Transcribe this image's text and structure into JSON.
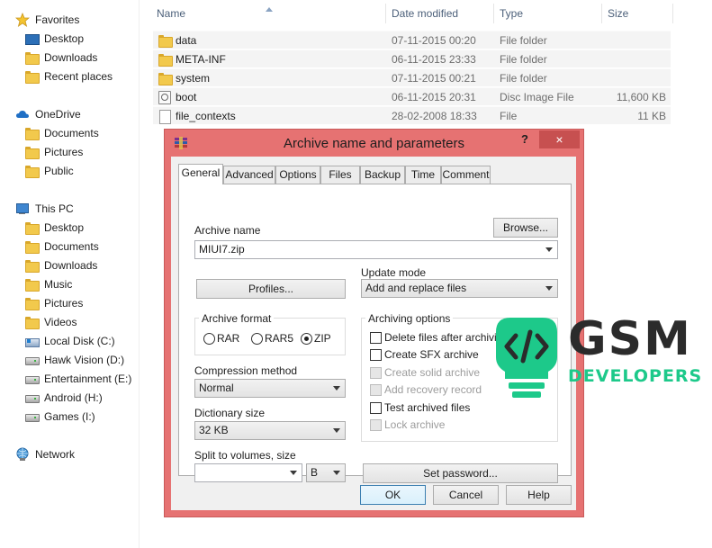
{
  "nav": {
    "favorites": {
      "label": "Favorites",
      "items": [
        "Desktop",
        "Downloads",
        "Recent places"
      ]
    },
    "onedrive": {
      "label": "OneDrive",
      "items": [
        "Documents",
        "Pictures",
        "Public"
      ]
    },
    "thispc": {
      "label": "This PC",
      "items": [
        "Desktop",
        "Documents",
        "Downloads",
        "Music",
        "Pictures",
        "Videos"
      ]
    },
    "drives": [
      "Local Disk (C:)",
      "Hawk Vision (D:)",
      "Entertainment (E:)",
      "Android (H:)",
      "Games (I:)"
    ],
    "network": {
      "label": "Network"
    }
  },
  "filelist": {
    "columns": {
      "name": "Name",
      "date": "Date modified",
      "type": "Type",
      "size": "Size"
    },
    "rows": [
      {
        "name": "data",
        "date": "07-11-2015 00:20",
        "type": "File folder",
        "size": "",
        "icon": "folder-icon"
      },
      {
        "name": "META-INF",
        "date": "06-11-2015 23:33",
        "type": "File folder",
        "size": "",
        "icon": "folder-icon"
      },
      {
        "name": "system",
        "date": "07-11-2015 00:21",
        "type": "File folder",
        "size": "",
        "icon": "folder-icon"
      },
      {
        "name": "boot",
        "date": "06-11-2015 20:31",
        "type": "Disc Image File",
        "size": "11,600 KB",
        "icon": "disc-image-icon"
      },
      {
        "name": "file_contexts",
        "date": "28-02-2008 18:33",
        "type": "File",
        "size": "11 KB",
        "icon": "file-icon"
      }
    ]
  },
  "dialog": {
    "title": "Archive name and parameters",
    "help_glyph": "?",
    "close_glyph": "×",
    "tabs": [
      "General",
      "Advanced",
      "Options",
      "Files",
      "Backup",
      "Time",
      "Comment"
    ],
    "active_tab": "General",
    "archive_name_label": "Archive name",
    "browse_label": "Browse...",
    "archive_name_value": "MIUI7.zip",
    "update_mode_label": "Update mode",
    "profiles_label": "Profiles...",
    "update_mode_value": "Add and replace files",
    "archive_format_label": "Archive format",
    "formats": [
      {
        "label": "RAR",
        "selected": false
      },
      {
        "label": "RAR5",
        "selected": false
      },
      {
        "label": "ZIP",
        "selected": true
      }
    ],
    "compression_method_label": "Compression method",
    "compression_method_value": "Normal",
    "dictionary_size_label": "Dictionary size",
    "dictionary_size_value": "32 KB",
    "split_label": "Split to volumes, size",
    "split_value": "",
    "split_unit": "B",
    "archiving_options_label": "Archiving options",
    "options": [
      {
        "label": "Delete files after archiving",
        "checked": false,
        "enabled": true
      },
      {
        "label": "Create SFX archive",
        "checked": false,
        "enabled": true
      },
      {
        "label": "Create solid archive",
        "checked": false,
        "enabled": false
      },
      {
        "label": "Add recovery record",
        "checked": false,
        "enabled": false
      },
      {
        "label": "Test archived files",
        "checked": false,
        "enabled": true
      },
      {
        "label": "Lock archive",
        "checked": false,
        "enabled": false
      }
    ],
    "set_password_label": "Set password...",
    "ok_label": "OK",
    "cancel_label": "Cancel",
    "help_label": "Help"
  },
  "watermark": {
    "title": "GSM",
    "subtitle": "DEVELOPERS",
    "accent_color": "#1dc98a"
  },
  "colors": {
    "dialog_frame": "#e67272",
    "close_button": "#c75050",
    "header_text": "#4c607a"
  }
}
